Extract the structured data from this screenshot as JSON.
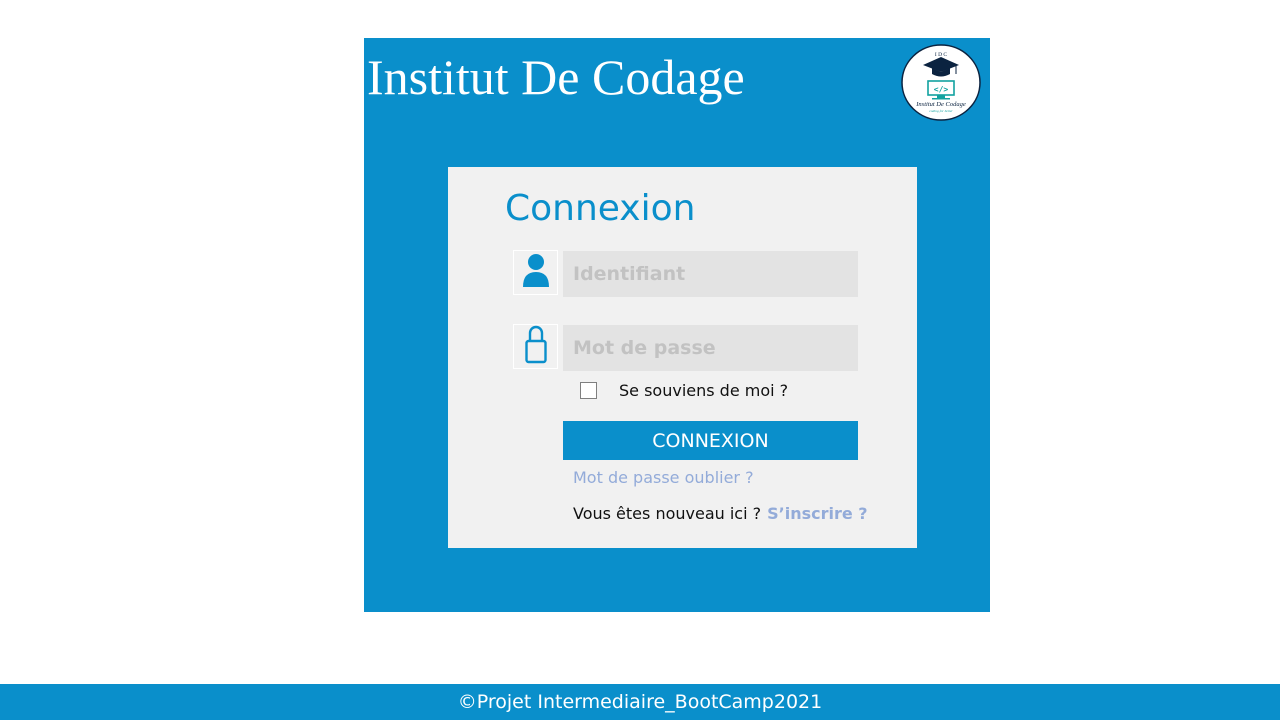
{
  "header": {
    "title": "Institut De Codage",
    "logo": {
      "top_text": "I D C",
      "code_symbol": "</>",
      "name": "Institut De Codage",
      "tagline": "coding for better"
    }
  },
  "login": {
    "title": "Connexion",
    "username": {
      "placeholder": "Identifiant",
      "value": ""
    },
    "password": {
      "placeholder": "Mot de passe",
      "value": ""
    },
    "remember_label": "Se souviens de moi ?",
    "remember_checked": false,
    "submit_label": "CONNEXION",
    "forgot_link": "Mot de passe oublier ?",
    "new_user_text": "Vous êtes nouveau ici  ?",
    "signup_link": "S’inscrire ?"
  },
  "footer": {
    "text": "©Projet Intermediaire_BootCamp2021"
  },
  "icons": {
    "user": "user-icon",
    "password": "lock-icon"
  },
  "colors": {
    "primary": "#0a8fcb",
    "card_background": "#f1f1f1",
    "field_background": "#e3e3e3",
    "link": "#93abd9",
    "logo_navy": "#0b2340",
    "logo_teal": "#12a2a0"
  }
}
